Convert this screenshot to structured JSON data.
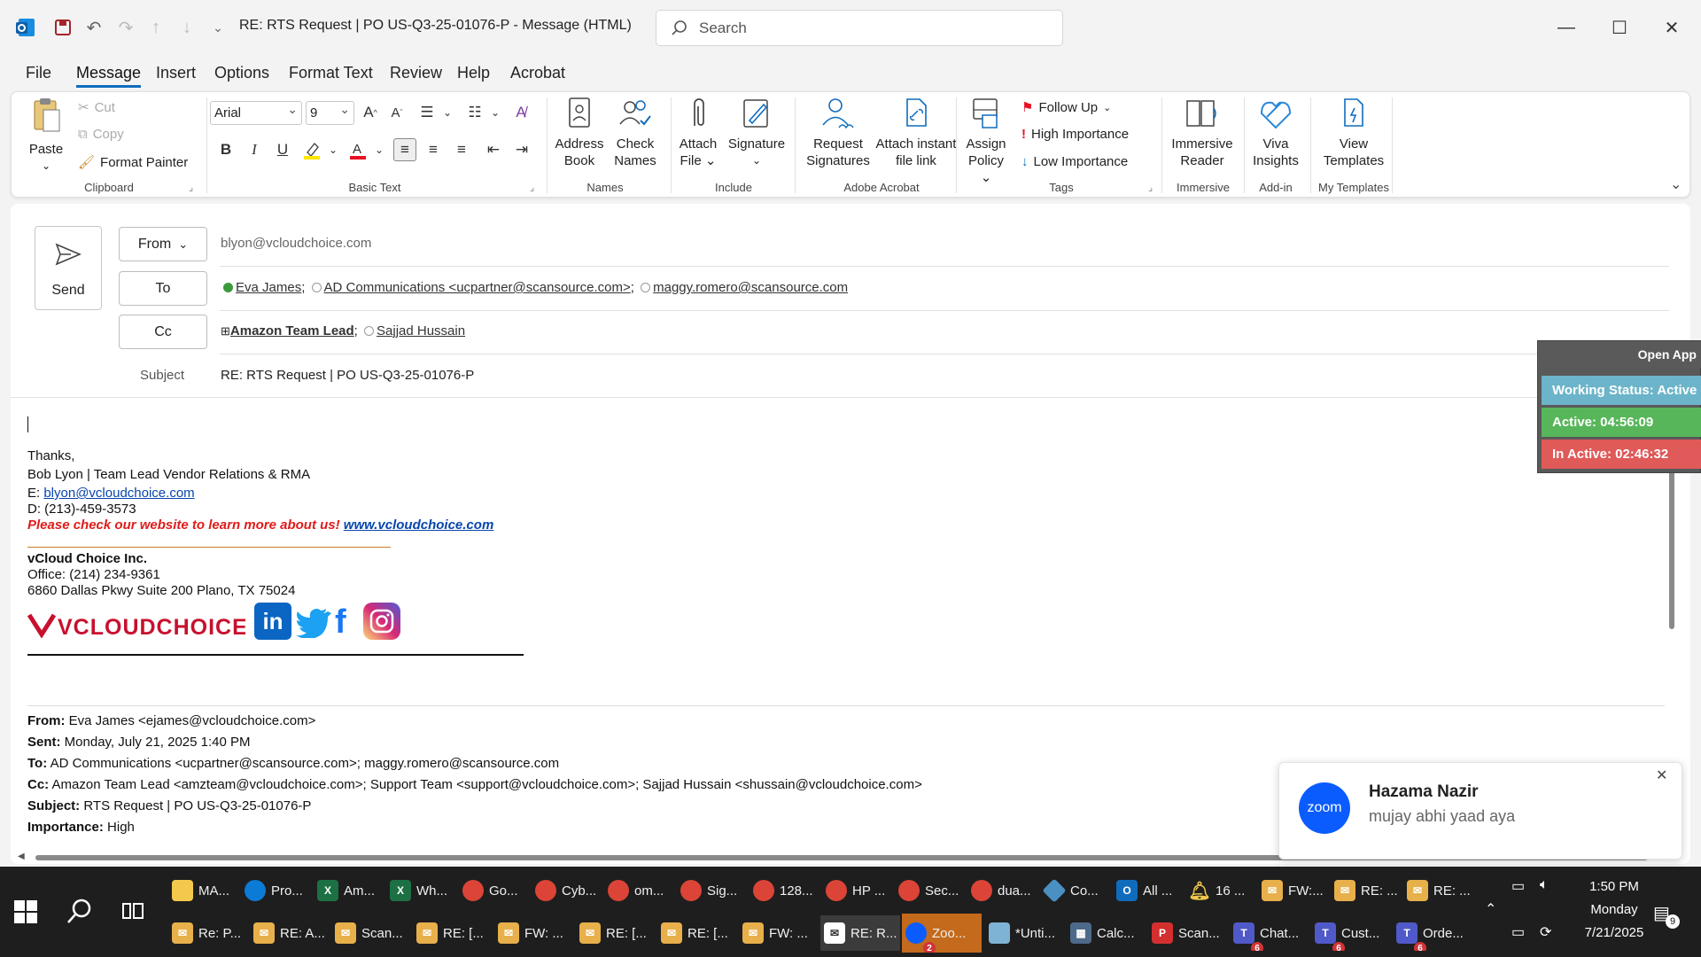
{
  "window": {
    "title": "RE: RTS Request | PO US-Q3-25-01076-P  -  Message (HTML)",
    "search_placeholder": "Search"
  },
  "menu": {
    "tabs": [
      "File",
      "Message",
      "Insert",
      "Options",
      "Format Text",
      "Review",
      "Help",
      "Acrobat"
    ],
    "active": "Message"
  },
  "ribbon": {
    "clipboard": {
      "paste": "Paste",
      "cut": "Cut",
      "copy": "Copy",
      "format_painter": "Format Painter",
      "label": "Clipboard"
    },
    "basic_text": {
      "font": "Arial",
      "size": "9",
      "label": "Basic Text"
    },
    "names": {
      "address_book": [
        "Address",
        "Book"
      ],
      "check_names": [
        "Check",
        "Names"
      ],
      "label": "Names"
    },
    "include": {
      "attach_file": [
        "Attach",
        "File"
      ],
      "signature": "Signature",
      "label": "Include"
    },
    "adobe": {
      "request_signatures": [
        "Request",
        "Signatures"
      ],
      "attach_link": [
        "Attach instant",
        "file link"
      ],
      "label": "Adobe Acrobat"
    },
    "tags": {
      "assign_policy": [
        "Assign",
        "Policy"
      ],
      "follow_up": "Follow Up",
      "high": "High Importance",
      "low": "Low Importance",
      "label": "Tags"
    },
    "immersive": {
      "reader": [
        "Immersive",
        "Reader"
      ],
      "label": "Immersive"
    },
    "addin": {
      "viva": [
        "Viva",
        "Insights"
      ],
      "label": "Add-in"
    },
    "templates": {
      "view": [
        "View",
        "Templates"
      ],
      "label": "My Templates"
    }
  },
  "compose": {
    "send": "Send",
    "from_label": "From",
    "from_value": "blyon@vcloudchoice.com",
    "to_label": "To",
    "to": [
      "Eva James",
      "AD Communications <ucpartner@scansource.com>",
      "maggy.romero@scansource.com"
    ],
    "cc_label": "Cc",
    "cc": [
      "Amazon Team Lead",
      "Sajjad Hussain"
    ],
    "subject_label": "Subject",
    "subject": "RE: RTS Request | PO US-Q3-25-01076-P"
  },
  "signature": {
    "thanks": "Thanks,",
    "name_line": "Bob Lyon | Team Lead Vendor Relations & RMA",
    "email_prefix": "E: ",
    "email": "blyon@vcloudchoice.com",
    "phone": "D: (213)-459-3573",
    "promo": "Please check our website to learn more about us!",
    "website": "www.vcloudchoice.com",
    "company": "vCloud Choice Inc.",
    "office": "Office: (214) 234-9361",
    "address": "6860 Dallas Pkwy Suite 200 Plano, TX 75024",
    "logo_text": "VCLOUDCHOICE"
  },
  "quoted": {
    "from_label": "From:",
    "from": "Eva James <ejames@vcloudchoice.com>",
    "sent_label": "Sent:",
    "sent": "Monday, July 21, 2025 1:40 PM",
    "to_label": "To:",
    "to": "AD Communications <ucpartner@scansource.com>; maggy.romero@scansource.com",
    "cc_label": "Cc:",
    "cc": "Amazon Team Lead <amzteam@vcloudchoice.com>; Support Team <support@vcloudchoice.com>; Sajjad Hussain <shussain@vcloudchoice.com>",
    "subject_label": "Subject:",
    "subject": "RTS Request | PO US-Q3-25-01076-P",
    "importance_label": "Importance:",
    "importance": "High"
  },
  "widget": {
    "open_app": "Open App",
    "status": "Working Status: Active",
    "active": "Active: 04:56:09",
    "inactive": "In Active: 02:46:32"
  },
  "toast": {
    "app": "zoom",
    "sender": "Hazama Nazir",
    "message": "mujay abhi yaad aya"
  },
  "taskbar": {
    "row1": [
      "MA...",
      "Pro...",
      "Am...",
      "Wh...",
      "Go...",
      "Cyb...",
      "om...",
      "Sig...",
      "128...",
      "HP ...",
      "Sec...",
      "dua...",
      "Co...",
      "All ...",
      "16 ...",
      "FW:...",
      "RE: ...",
      "RE: ..."
    ],
    "row2": [
      "Re: P...",
      "RE: A...",
      "Scan...",
      "RE: [...",
      "FW: ...",
      "RE: [...",
      "RE: [...",
      "FW: ...",
      "RE: R...",
      "Zoo...",
      "*Unti...",
      "Calc...",
      "Scan...",
      "Chat...",
      "Cust...",
      "Orde..."
    ],
    "badges": {
      "zoom": "2",
      "chat": "6",
      "cust": "6",
      "orde": "6",
      "notif": "9"
    },
    "time": "1:50 PM",
    "day": "Monday",
    "date": "7/21/2025"
  },
  "colors": {
    "accent": "#0f6cbd",
    "brand_red": "#c8102e",
    "zoom_blue": "#0b5cff",
    "widget_status": "#6cb4c9",
    "widget_active": "#57b65a",
    "widget_inactive": "#e05a5a"
  }
}
